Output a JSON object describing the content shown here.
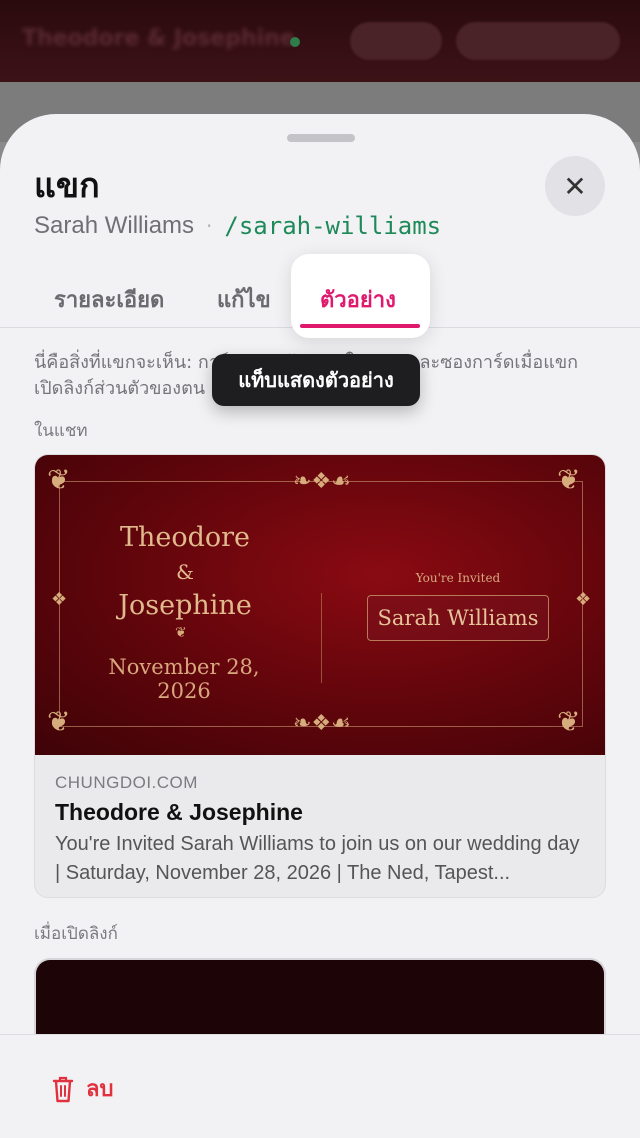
{
  "background": {
    "title": "Theodore & Josephine",
    "status_color": "#2e7d4a"
  },
  "sheet": {
    "title": "แขก",
    "guest_name": "Sarah Williams",
    "separator": "·",
    "slug": "/sarah-williams",
    "close_icon": "close-icon"
  },
  "tabs": [
    {
      "label": "รายละเอียด",
      "active": false
    },
    {
      "label": "แก้ไข",
      "active": false
    },
    {
      "label": "ตัวอย่าง",
      "active": true
    }
  ],
  "tooltip": "แท็บแสดงตัวอย่าง",
  "description": "นี่คือสิ่งที่แขกจะเห็น: การ์ดแสดงตัวอย่างในแชท และซองการ์ดเมื่อแขกเปิดลิงก์ส่วนตัวของตน",
  "sections": {
    "in_chat": "ในแชท",
    "when_opened": "เมื่อเปิดลิงก์"
  },
  "invitation": {
    "name1": "Theodore",
    "ampersand": "&",
    "name2": "Josephine",
    "date": "November 28, 2026",
    "invited_label": "You're Invited",
    "guest": "Sarah Williams"
  },
  "link_preview": {
    "domain": "CHUNGDOI.COM",
    "title": "Theodore & Josephine",
    "description": "You're Invited Sarah Williams to join us on our wedding day | Saturday, November 28, 2026 | The Ned, Tapest..."
  },
  "footer": {
    "delete_label": "ลบ",
    "delete_color": "#e0323e"
  },
  "colors": {
    "accent": "#e0196e",
    "slug": "#1e8a5a",
    "invite_bg": "#6a060c",
    "gold": "#d7ac7c"
  }
}
